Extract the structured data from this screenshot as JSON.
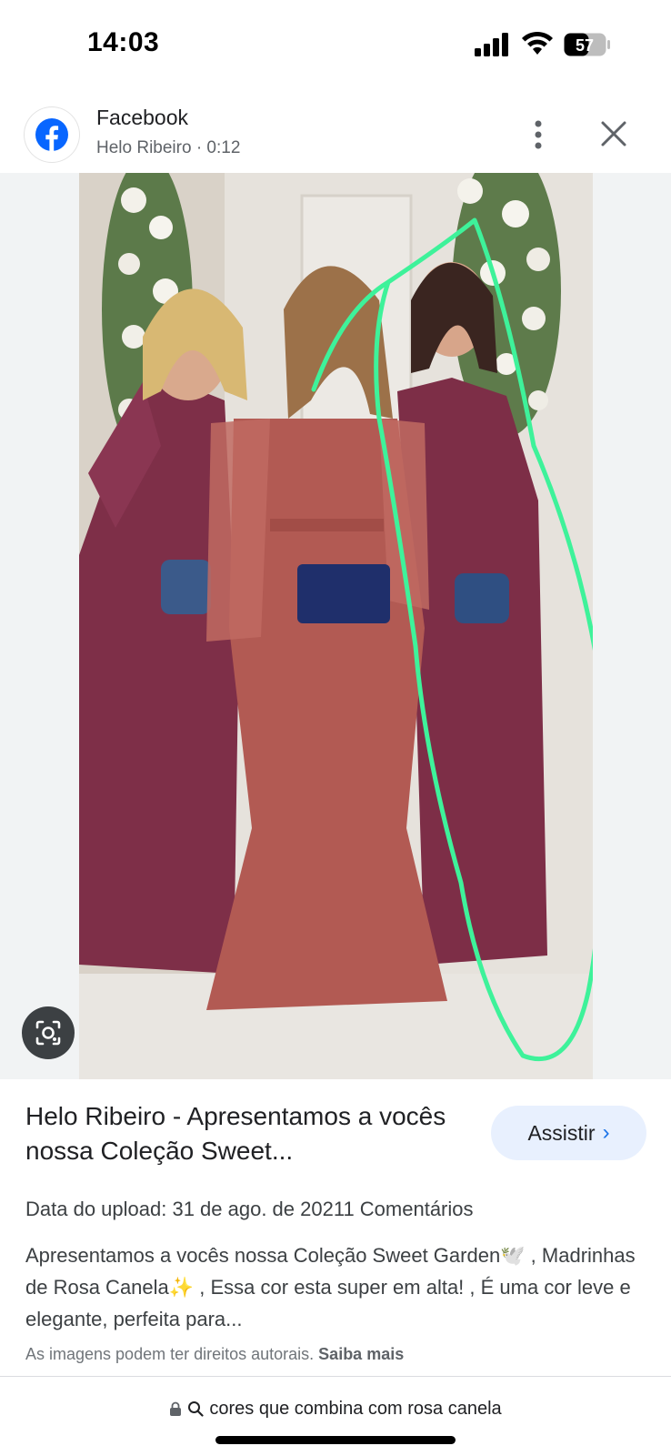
{
  "status_bar": {
    "time": "14:03",
    "battery": "57"
  },
  "header": {
    "source_name": "Facebook",
    "source_sub": "Helo Ribeiro · 0:12",
    "logo_icon": "facebook-icon",
    "more_icon": "more-vert-icon",
    "close_icon": "close-icon"
  },
  "image": {
    "lens_icon": "google-lens-icon"
  },
  "info": {
    "title": "Helo Ribeiro - Apresentamos a vocês nossa Coleção Sweet...",
    "watch_label": "Assistir",
    "meta": "Data do upload: 31 de ago. de 20211 Comentários",
    "description": "Apresentamos a vocês nossa Coleção Sweet Garden🕊️ , Madrinhas de Rosa Canela✨ , Essa cor esta super em alta! , É uma cor leve e elegante, perfeita para...",
    "copyright_text": "As imagens podem ter direitos autorais.",
    "learn_more": "Saiba mais"
  },
  "url_bar": {
    "text": "cores que combina com rosa canela"
  },
  "colors": {
    "accent": "#1a73e8",
    "facebook": "#0866ff",
    "annotation": "#3ef29a"
  }
}
